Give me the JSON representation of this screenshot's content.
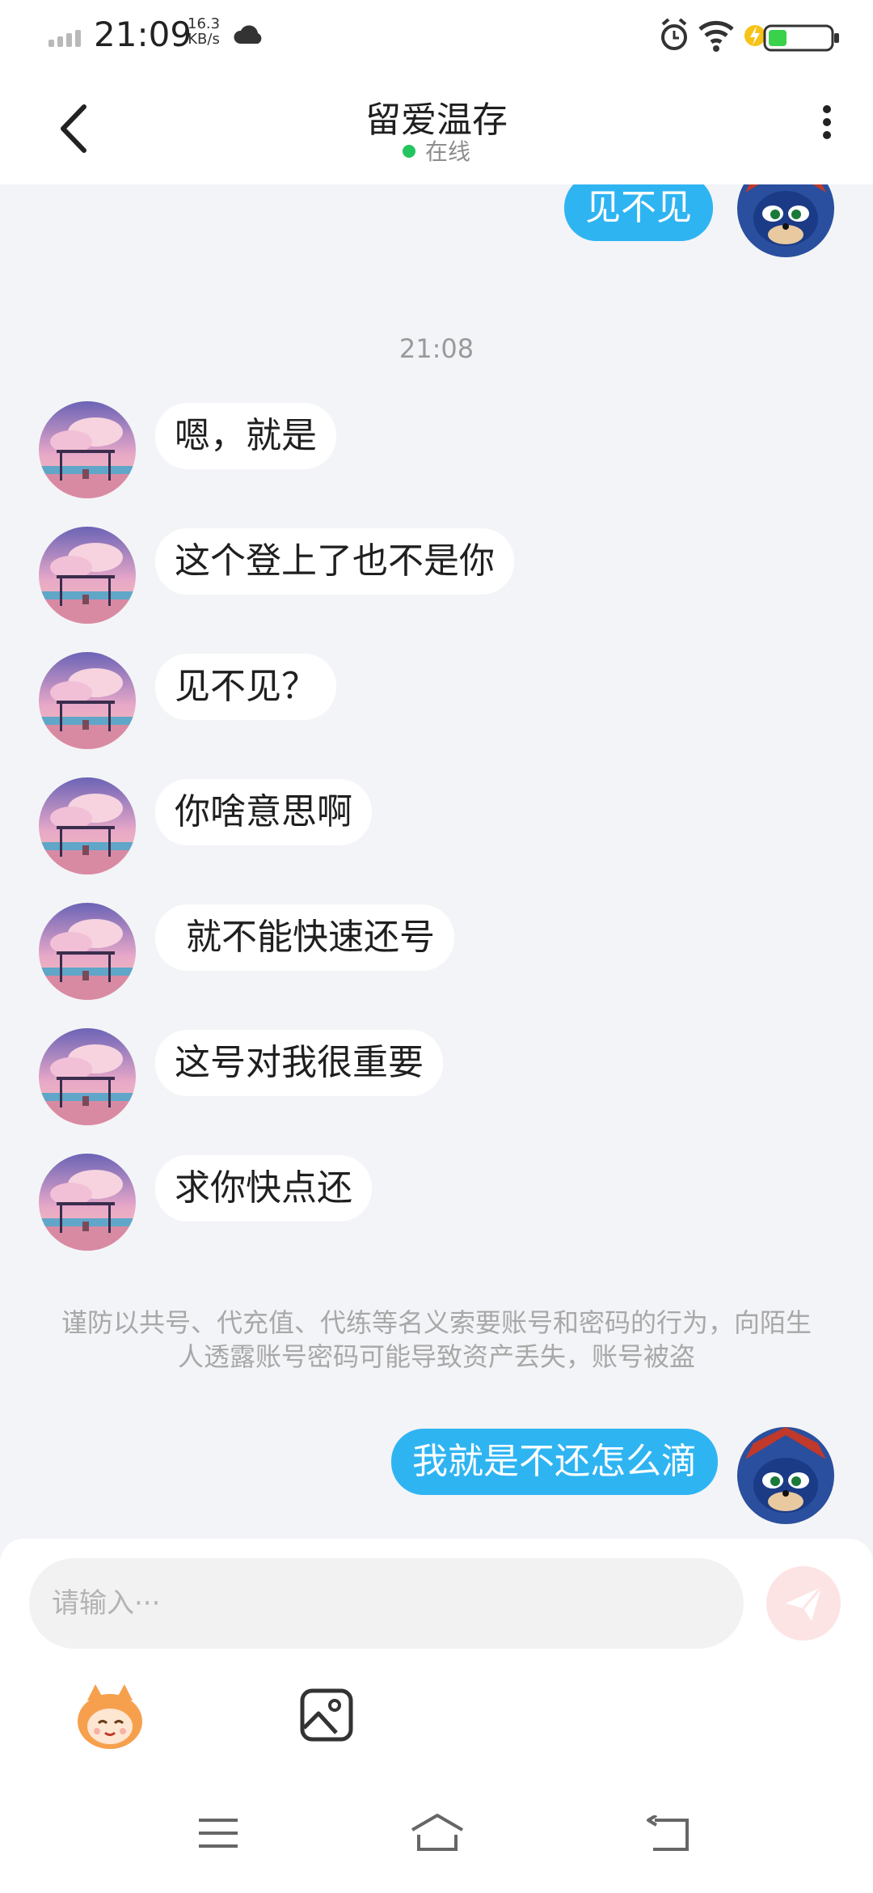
{
  "status_bar": {
    "time": "21:09",
    "speed_value": "16.3",
    "speed_unit": "KB/s"
  },
  "header": {
    "title": "留爱温存",
    "status": "在线"
  },
  "chat": {
    "top_message": "见不见",
    "timestamp": "21:08",
    "incoming": [
      "嗯，就是",
      "这个登上了也不是你",
      "见不见？",
      "你啥意思啊",
      " 就不能快速还号",
      "这号对我很重要",
      "求你快点还"
    ],
    "security_notice": "谨防以共号、代充值、代练等名义索要账号和密码的行为，向陌生人透露账号密码可能导致资产丢失，账号被盗",
    "last_message": "我就是不还怎么滴"
  },
  "input": {
    "placeholder": "请输入···"
  },
  "colors": {
    "outgoing_bubble": "#2fb4f2",
    "incoming_bubble": "#ffffff",
    "background": "#f3f4f7",
    "online_dot": "#22c55e",
    "send_button": "#fde4e4"
  }
}
